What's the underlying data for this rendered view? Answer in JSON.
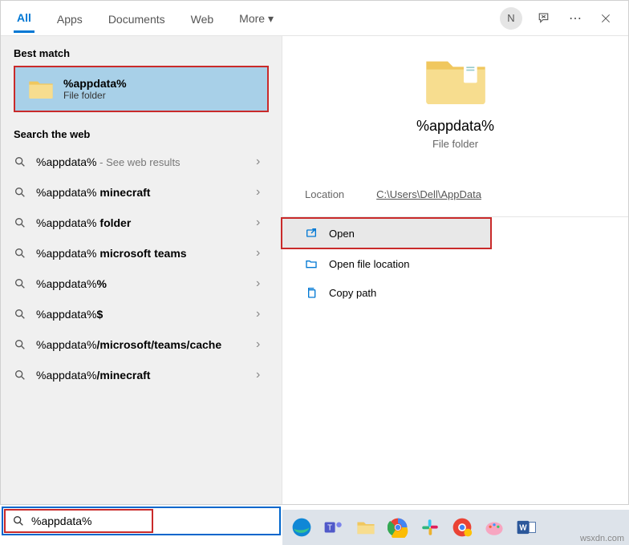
{
  "tabs": {
    "all": "All",
    "apps": "Apps",
    "docs": "Documents",
    "web": "Web",
    "more": "More"
  },
  "avatar_letter": "N",
  "left": {
    "best_match_header": "Best match",
    "best_match": {
      "title": "%appdata%",
      "subtitle": "File folder"
    },
    "web_header": "Search the web",
    "web_items": [
      {
        "prefix": "%appdata%",
        "bold": "",
        "suffix": " - See web results"
      },
      {
        "prefix": "%appdata% ",
        "bold": "minecraft",
        "suffix": ""
      },
      {
        "prefix": "%appdata% ",
        "bold": "folder",
        "suffix": ""
      },
      {
        "prefix": "%appdata% ",
        "bold": "microsoft teams",
        "suffix": ""
      },
      {
        "prefix": "%appdata%",
        "bold": "%",
        "suffix": ""
      },
      {
        "prefix": "%appdata%",
        "bold": "$",
        "suffix": ""
      },
      {
        "prefix": "%appdata%",
        "bold": "/microsoft/teams/cache",
        "suffix": ""
      },
      {
        "prefix": "%appdata%",
        "bold": "/minecraft",
        "suffix": ""
      }
    ]
  },
  "right": {
    "title": "%appdata%",
    "subtitle": "File folder",
    "location_label": "Location",
    "location_value": "C:\\Users\\Dell\\AppData",
    "actions": {
      "open": "Open",
      "openloc": "Open file location",
      "copypath": "Copy path"
    }
  },
  "search_value": "%appdata%",
  "watermark": "wsxdn.com"
}
